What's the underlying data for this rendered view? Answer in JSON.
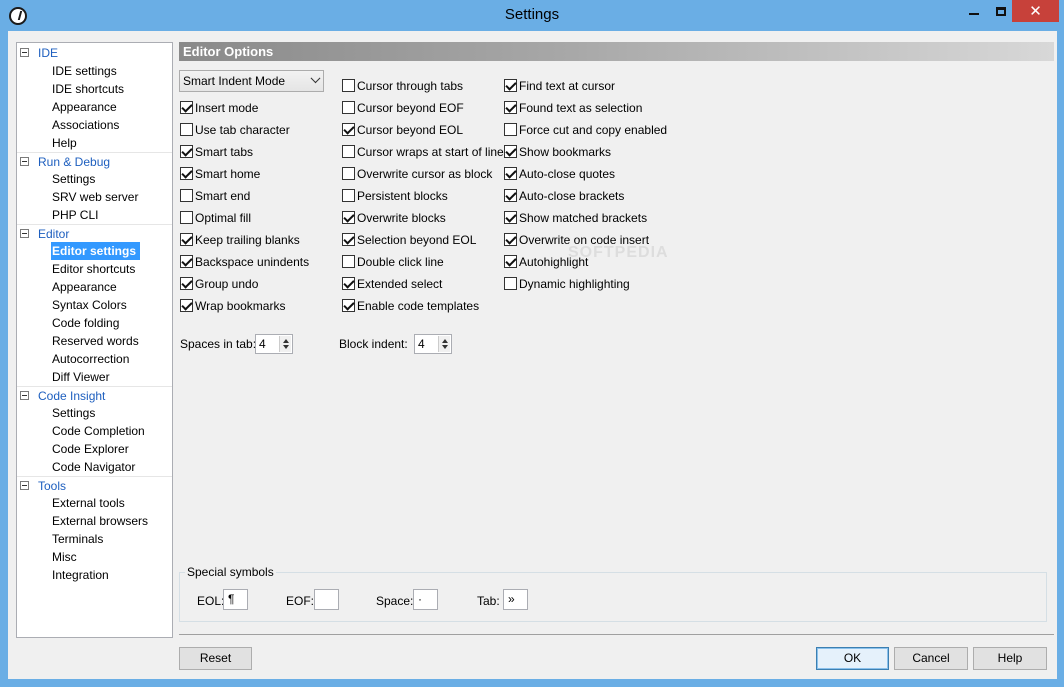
{
  "window": {
    "title": "Settings",
    "minimize_glyph": "",
    "close_glyph": "✕"
  },
  "tree": {
    "categories": [
      {
        "label": "IDE",
        "items": [
          "IDE settings",
          "IDE shortcuts",
          "Appearance",
          "Associations",
          "Help"
        ]
      },
      {
        "label": "Run & Debug",
        "items": [
          "Settings",
          "SRV web server",
          "PHP CLI"
        ]
      },
      {
        "label": "Editor",
        "items": [
          "Editor settings",
          "Editor shortcuts",
          "Appearance",
          "Syntax Colors",
          "Code folding",
          "Reserved words",
          "Autocorrection",
          "Diff Viewer"
        ]
      },
      {
        "label": "Code Insight",
        "items": [
          "Settings",
          "Code Completion",
          "Code Explorer",
          "Code Navigator"
        ]
      },
      {
        "label": "Tools",
        "items": [
          "External tools",
          "External browsers",
          "Terminals",
          "Misc",
          "Integration"
        ]
      }
    ],
    "selected": "Editor settings"
  },
  "panel": {
    "header": "Editor Options",
    "indent_mode": "Smart Indent Mode",
    "col1": [
      {
        "label": "Insert mode",
        "checked": true
      },
      {
        "label": "Use tab character",
        "checked": false
      },
      {
        "label": "Smart tabs",
        "checked": true
      },
      {
        "label": "Smart home",
        "checked": true
      },
      {
        "label": "Smart end",
        "checked": false
      },
      {
        "label": "Optimal fill",
        "checked": false
      },
      {
        "label": "Keep trailing blanks",
        "checked": true
      },
      {
        "label": "Backspace unindents",
        "checked": true
      },
      {
        "label": "Group undo",
        "checked": true
      },
      {
        "label": "Wrap bookmarks",
        "checked": true
      }
    ],
    "col2": [
      {
        "label": "Cursor through tabs",
        "checked": false
      },
      {
        "label": "Cursor beyond EOF",
        "checked": false
      },
      {
        "label": "Cursor beyond EOL",
        "checked": true
      },
      {
        "label": "Cursor wraps at start of line",
        "checked": false
      },
      {
        "label": "Overwrite cursor as block",
        "checked": false
      },
      {
        "label": "Persistent blocks",
        "checked": false
      },
      {
        "label": "Overwrite blocks",
        "checked": true
      },
      {
        "label": "Selection beyond EOL",
        "checked": true
      },
      {
        "label": "Double click line",
        "checked": false
      },
      {
        "label": "Extended select",
        "checked": true
      },
      {
        "label": "Enable code templates",
        "checked": true
      }
    ],
    "col3": [
      {
        "label": "Find text at cursor",
        "checked": true
      },
      {
        "label": "Found text as selection",
        "checked": true
      },
      {
        "label": "Force cut and copy enabled",
        "checked": false
      },
      {
        "label": "Show bookmarks",
        "checked": true
      },
      {
        "label": "Auto-close quotes",
        "checked": true
      },
      {
        "label": "Auto-close brackets",
        "checked": true
      },
      {
        "label": "Show matched brackets",
        "checked": true
      },
      {
        "label": "Overwrite on code insert",
        "checked": true
      },
      {
        "label": "Autohighlight",
        "checked": true
      },
      {
        "label": "Dynamic highlighting",
        "checked": false
      }
    ],
    "spaces_in_tab_label": "Spaces in tab:",
    "spaces_in_tab_value": "4",
    "block_indent_label": "Block indent:",
    "block_indent_value": "4",
    "watermark": "SOFTPEDIA"
  },
  "special_symbols": {
    "title": "Special symbols",
    "eol_label": "EOL:",
    "eol_value": "¶",
    "eof_label": "EOF:",
    "eof_value": "",
    "space_label": "Space:",
    "space_value": "·",
    "tab_label": "Tab:",
    "tab_value": "»"
  },
  "buttons": {
    "reset": "Reset",
    "ok": "OK",
    "cancel": "Cancel",
    "help": "Help"
  }
}
